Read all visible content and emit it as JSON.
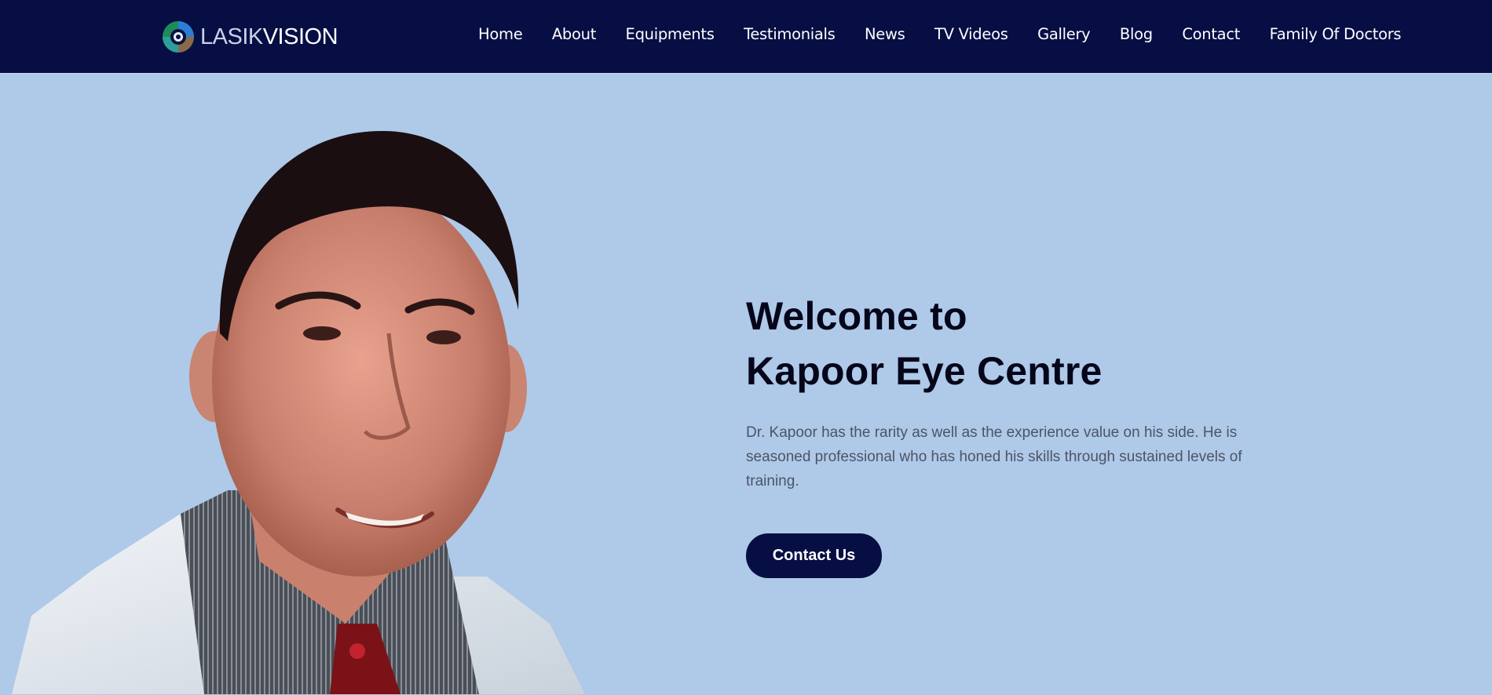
{
  "header": {
    "logo": {
      "part1": "LASIK",
      "part2": "VISION"
    },
    "nav": [
      "Home",
      "About",
      "Equipments",
      "Testimonials",
      "News",
      "TV Videos",
      "Gallery",
      "Blog",
      "Contact",
      "Family Of Doctors"
    ]
  },
  "hero": {
    "title_line1": "Welcome to",
    "title_line2": "Kapoor Eye Centre",
    "description": "Dr. Kapoor has the rarity as well as the experience value on his side. He is seasoned professional who has honed his skills through sustained levels of training.",
    "cta_label": "Contact Us",
    "image_alt": "Dr. Kapoor portrait"
  },
  "colors": {
    "header_bg": "#060e44",
    "hero_bg": "#afc9e8",
    "button_bg": "#060e44",
    "title_text": "#05061a",
    "body_text": "#4b5566"
  }
}
